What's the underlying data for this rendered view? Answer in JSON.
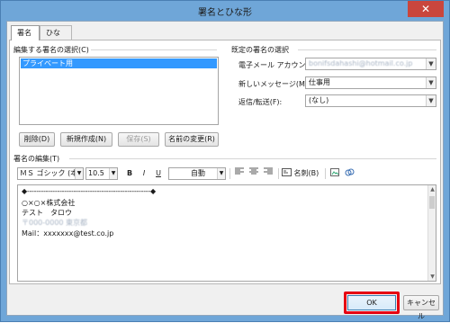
{
  "window": {
    "title": "署名とひな形",
    "close": "✕"
  },
  "tabs": [
    {
      "label": "署名"
    },
    {
      "label": "ひな形"
    }
  ],
  "left": {
    "group_label": "編集する署名の選択(C)",
    "list_items": [
      "プライベート用"
    ],
    "buttons": {
      "delete": "削除(D)",
      "new": "新規作成(N)",
      "save": "保存(S)",
      "rename": "名前の変更(R)"
    }
  },
  "right": {
    "group_label": "既定の署名の選択",
    "email_label": "電子メール アカウント(A):",
    "email_value": "bonifsdahashi@hotmail.co.jp",
    "new_msg_label": "新しいメッセージ(M):",
    "new_msg_value": "仕事用",
    "reply_label": "返信/転送(F):",
    "reply_value": "(なし)"
  },
  "editor": {
    "group_label": "署名の編集(T)",
    "font": "ＭＳ ゴシック (本文",
    "size": "10.5",
    "bold": "B",
    "italic": "I",
    "underline": "U",
    "color": "自動",
    "business_card": "名刺(B)",
    "lines": [
      "◆-----------------------------------------------------◆",
      "○×○×株式会社",
      "テスト　タロウ",
      "〒000-0000 東京都",
      "Mail：xxxxxxx@test.co.jp"
    ]
  },
  "footer": {
    "ok": "OK",
    "cancel": "キャンセル"
  },
  "colors": {
    "title_bar": "#6fa6d8",
    "selection": "#3399ff",
    "highlight": "#e60012",
    "close": "#c9463d"
  }
}
